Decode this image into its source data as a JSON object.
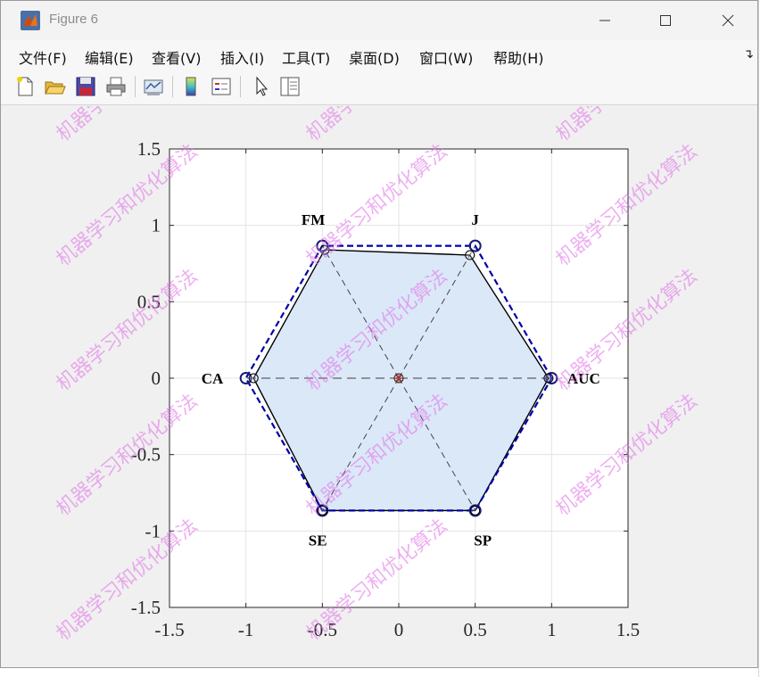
{
  "window": {
    "title": "Figure 6"
  },
  "menu": [
    {
      "label": "文件(F)"
    },
    {
      "label": "编辑(E)"
    },
    {
      "label": "查看(V)"
    },
    {
      "label": "插入(I)"
    },
    {
      "label": "工具(T)"
    },
    {
      "label": "桌面(D)"
    },
    {
      "label": "窗口(W)"
    },
    {
      "label": "帮助(H)"
    }
  ],
  "toolbar": [
    {
      "icon": "new-figure-icon"
    },
    {
      "icon": "open-icon"
    },
    {
      "icon": "save-icon"
    },
    {
      "icon": "print-icon"
    },
    {
      "icon": "link-plot-icon"
    },
    {
      "icon": "colorbar-icon"
    },
    {
      "icon": "legend-icon"
    },
    {
      "icon": "pointer-icon"
    },
    {
      "icon": "property-inspector-icon"
    }
  ],
  "watermark": "机器学习和优化算法",
  "chart_data": {
    "type": "radar",
    "xlim": [
      -1.5,
      1.5
    ],
    "ylim": [
      -1.5,
      1.5
    ],
    "xticks": [
      "-1.5",
      "-1",
      "-0.5",
      "0",
      "0.5",
      "1",
      "1.5"
    ],
    "yticks": [
      "1.5",
      "1",
      "0.5",
      "0",
      "-0.5",
      "-1",
      "-1.5"
    ],
    "grid": true,
    "axes_labels": [
      "AUC",
      "J",
      "FM",
      "CA",
      "SE",
      "SP"
    ],
    "angles_deg": [
      0,
      60,
      120,
      180,
      240,
      300
    ],
    "series": [
      {
        "values": [
          1,
          1,
          1,
          1,
          1,
          1
        ],
        "color": "#0000aa",
        "style": "dashed",
        "marker": "circle"
      },
      {
        "values": [
          0.98,
          0.93,
          0.97,
          0.95,
          1.0,
          1.0
        ],
        "color": "#000000",
        "style": "solid",
        "fill": "#dbe8f8",
        "marker": "circle"
      }
    ],
    "colors": {
      "grid": "#e3e3e3",
      "spoke": "#444444",
      "background": "#ffffff"
    }
  }
}
